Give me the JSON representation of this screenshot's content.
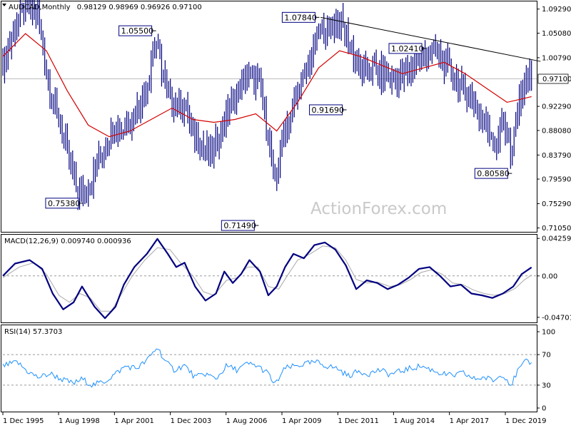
{
  "chart_data": [
    {
      "type": "bar",
      "subtype": "ohlc",
      "symbol_header": "AUDCAD,Monthly",
      "ohlc_header": "0.98129 0.98969 0.96926 0.97100",
      "current_price": 0.971,
      "current_price_label": "0.97100",
      "watermark": "ActionForex.com",
      "ylim": [
        0.705,
        1.105
      ],
      "yticks": [
        {
          "value": 1.0929,
          "label": "1.09290"
        },
        {
          "value": 1.0508,
          "label": "1.05080"
        },
        {
          "value": 1.0079,
          "label": "1.00790"
        },
        {
          "value": 0.9229,
          "label": "0.92290"
        },
        {
          "value": 0.8808,
          "label": "0.88080"
        },
        {
          "value": 0.8379,
          "label": "0.83790"
        },
        {
          "value": 0.7959,
          "label": "0.79590"
        },
        {
          "value": 0.7529,
          "label": "0.75290"
        },
        {
          "value": 0.7105,
          "label": "0.71050"
        }
      ],
      "x_range": [
        1995.92,
        2021.42
      ],
      "xticks": [
        {
          "x": 1995.92,
          "label": "1 Dec 1995"
        },
        {
          "x": 1998.58,
          "label": "1 Aug 1998"
        },
        {
          "x": 2001.25,
          "label": "1 Apr 2001"
        },
        {
          "x": 2003.92,
          "label": "1 Dec 2003"
        },
        {
          "x": 2006.58,
          "label": "1 Aug 2006"
        },
        {
          "x": 2009.25,
          "label": "1 Apr 2009"
        },
        {
          "x": 2011.92,
          "label": "1 Dec 2011"
        },
        {
          "x": 2014.58,
          "label": "1 Aug 2014"
        },
        {
          "x": 2017.25,
          "label": "1 Apr 2017"
        },
        {
          "x": 2019.92,
          "label": "1 Dec 2019"
        }
      ],
      "price_path": [
        [
          1995.92,
          1.0
        ],
        [
          1996.5,
          1.06
        ],
        [
          1996.9,
          1.095
        ],
        [
          1997.6,
          1.085
        ],
        [
          1998.1,
          0.96
        ],
        [
          1998.9,
          0.86
        ],
        [
          1999.4,
          0.78
        ],
        [
          1999.8,
          0.765
        ],
        [
          2000.3,
          0.81
        ],
        [
          2000.9,
          0.86
        ],
        [
          2001.2,
          0.89
        ],
        [
          2001.6,
          0.88
        ],
        [
          2002.0,
          0.9
        ],
        [
          2002.4,
          0.92
        ],
        [
          2002.8,
          0.96
        ],
        [
          2003.2,
          1.04
        ],
        [
          2003.4,
          1.01
        ],
        [
          2003.8,
          0.94
        ],
        [
          2004.2,
          0.93
        ],
        [
          2004.6,
          0.92
        ],
        [
          2005.0,
          0.88
        ],
        [
          2005.5,
          0.85
        ],
        [
          2005.9,
          0.84
        ],
        [
          2006.3,
          0.88
        ],
        [
          2006.7,
          0.92
        ],
        [
          2007.2,
          0.95
        ],
        [
          2007.6,
          0.98
        ],
        [
          2008.2,
          0.96
        ],
        [
          2008.6,
          0.87
        ],
        [
          2008.9,
          0.78
        ],
        [
          2009.2,
          0.86
        ],
        [
          2009.6,
          0.9
        ],
        [
          2009.9,
          0.94
        ],
        [
          2010.3,
          0.97
        ],
        [
          2010.7,
          1.02
        ],
        [
          2011.0,
          1.05
        ],
        [
          2011.5,
          1.06
        ],
        [
          2011.9,
          1.07
        ],
        [
          2012.2,
          1.06
        ],
        [
          2012.5,
          1.03
        ],
        [
          2012.8,
          1.0
        ],
        [
          2013.2,
          0.98
        ],
        [
          2013.6,
          0.99
        ],
        [
          2014.0,
          0.98
        ],
        [
          2014.4,
          0.97
        ],
        [
          2014.8,
          0.97
        ],
        [
          2015.2,
          0.98
        ],
        [
          2015.6,
          1.0
        ],
        [
          2016.0,
          1.01
        ],
        [
          2016.4,
          1.02
        ],
        [
          2016.8,
          1.01
        ],
        [
          2017.2,
          0.99
        ],
        [
          2017.6,
          0.97
        ],
        [
          2018.0,
          0.95
        ],
        [
          2018.4,
          0.93
        ],
        [
          2018.8,
          0.9
        ],
        [
          2019.2,
          0.88
        ],
        [
          2019.5,
          0.86
        ],
        [
          2019.8,
          0.9
        ],
        [
          2020.1,
          0.87
        ],
        [
          2020.2,
          0.81
        ],
        [
          2020.4,
          0.9
        ],
        [
          2020.7,
          0.95
        ],
        [
          2021.0,
          0.98
        ],
        [
          2021.17,
          0.975
        ]
      ],
      "ma_path": [
        [
          1995.92,
          1.01
        ],
        [
          1997.0,
          1.05
        ],
        [
          1998.0,
          1.02
        ],
        [
          1999.0,
          0.95
        ],
        [
          2000.0,
          0.89
        ],
        [
          2001.0,
          0.87
        ],
        [
          2002.0,
          0.88
        ],
        [
          2003.0,
          0.9
        ],
        [
          2004.0,
          0.92
        ],
        [
          2005.0,
          0.9
        ],
        [
          2006.0,
          0.895
        ],
        [
          2007.0,
          0.9
        ],
        [
          2008.0,
          0.91
        ],
        [
          2009.0,
          0.88
        ],
        [
          2010.0,
          0.93
        ],
        [
          2011.0,
          0.99
        ],
        [
          2012.0,
          1.02
        ],
        [
          2013.0,
          1.01
        ],
        [
          2014.0,
          0.995
        ],
        [
          2015.0,
          0.98
        ],
        [
          2016.0,
          0.99
        ],
        [
          2017.0,
          1.0
        ],
        [
          2018.0,
          0.98
        ],
        [
          2019.0,
          0.955
        ],
        [
          2020.0,
          0.93
        ],
        [
          2020.6,
          0.935
        ],
        [
          2021.17,
          0.94
        ]
      ],
      "trendline": [
        [
          2011.1,
          1.0784
        ],
        [
          2021.6,
          1.0015
        ]
      ],
      "annotations": [
        {
          "label": "1.05500",
          "x": 2003.1,
          "y": 1.055
        },
        {
          "label": "1.07840",
          "x": 2010.9,
          "y": 1.0784
        },
        {
          "label": "1.02410",
          "x": 2016.0,
          "y": 1.0241
        },
        {
          "label": "0.75380",
          "x": 1999.6,
          "y": 0.7538
        },
        {
          "label": "0.91690",
          "x": 2012.2,
          "y": 0.9169
        },
        {
          "label": "0.71490",
          "x": 2008.0,
          "y": 0.7149
        },
        {
          "label": "0.80580",
          "x": 2020.1,
          "y": 0.8058
        }
      ]
    },
    {
      "type": "line",
      "title": "MACD(12,26,9) 0.009740 0.000936",
      "ylim": [
        -0.052,
        0.046
      ],
      "yticks": [
        {
          "value": 0.042599,
          "label": "0.042599"
        },
        {
          "value": 0.0,
          "label": "0.00"
        },
        {
          "value": -0.047016,
          "label": "-0.047016"
        }
      ],
      "macd": [
        [
          1995.92,
          0.0
        ],
        [
          1996.5,
          0.014
        ],
        [
          1997.2,
          0.018
        ],
        [
          1997.8,
          0.008
        ],
        [
          1998.3,
          -0.02
        ],
        [
          1998.8,
          -0.038
        ],
        [
          1999.3,
          -0.03
        ],
        [
          1999.7,
          -0.012
        ],
        [
          2000.3,
          -0.035
        ],
        [
          2000.8,
          -0.048
        ],
        [
          2001.3,
          -0.035
        ],
        [
          2001.7,
          -0.01
        ],
        [
          2002.2,
          0.01
        ],
        [
          2002.8,
          0.025
        ],
        [
          2003.3,
          0.042
        ],
        [
          2003.8,
          0.025
        ],
        [
          2004.2,
          0.01
        ],
        [
          2004.6,
          0.015
        ],
        [
          2005.1,
          -0.012
        ],
        [
          2005.6,
          -0.028
        ],
        [
          2006.1,
          -0.02
        ],
        [
          2006.5,
          0.005
        ],
        [
          2006.9,
          -0.008
        ],
        [
          2007.3,
          0.002
        ],
        [
          2007.7,
          0.018
        ],
        [
          2008.2,
          0.005
        ],
        [
          2008.6,
          -0.022
        ],
        [
          2009.0,
          -0.012
        ],
        [
          2009.4,
          0.01
        ],
        [
          2009.8,
          0.025
        ],
        [
          2010.3,
          0.02
        ],
        [
          2010.8,
          0.035
        ],
        [
          2011.3,
          0.038
        ],
        [
          2011.8,
          0.03
        ],
        [
          2012.3,
          0.012
        ],
        [
          2012.8,
          -0.015
        ],
        [
          2013.3,
          -0.005
        ],
        [
          2013.8,
          -0.008
        ],
        [
          2014.3,
          -0.015
        ],
        [
          2014.8,
          -0.01
        ],
        [
          2015.3,
          -0.002
        ],
        [
          2015.8,
          0.008
        ],
        [
          2016.3,
          0.01
        ],
        [
          2016.8,
          0.0
        ],
        [
          2017.3,
          -0.012
        ],
        [
          2017.8,
          -0.01
        ],
        [
          2018.3,
          -0.02
        ],
        [
          2018.8,
          -0.022
        ],
        [
          2019.3,
          -0.025
        ],
        [
          2019.8,
          -0.02
        ],
        [
          2020.3,
          -0.012
        ],
        [
          2020.7,
          0.002
        ],
        [
          2021.17,
          0.00974
        ]
      ],
      "signal": [
        [
          1995.92,
          -0.002
        ],
        [
          1996.7,
          0.01
        ],
        [
          1997.4,
          0.015
        ],
        [
          1998.0,
          0.002
        ],
        [
          1998.6,
          -0.022
        ],
        [
          1999.1,
          -0.03
        ],
        [
          1999.6,
          -0.02
        ],
        [
          2000.1,
          -0.025
        ],
        [
          2000.6,
          -0.04
        ],
        [
          2001.1,
          -0.04
        ],
        [
          2001.6,
          -0.02
        ],
        [
          2002.1,
          0.0
        ],
        [
          2002.7,
          0.018
        ],
        [
          2003.3,
          0.032
        ],
        [
          2003.9,
          0.03
        ],
        [
          2004.4,
          0.015
        ],
        [
          2005.0,
          0.0
        ],
        [
          2005.5,
          -0.018
        ],
        [
          2006.0,
          -0.022
        ],
        [
          2006.6,
          -0.005
        ],
        [
          2007.1,
          -0.002
        ],
        [
          2007.6,
          0.01
        ],
        [
          2008.1,
          0.01
        ],
        [
          2008.6,
          -0.012
        ],
        [
          2009.1,
          -0.015
        ],
        [
          2009.5,
          0.0
        ],
        [
          2010.0,
          0.018
        ],
        [
          2010.6,
          0.025
        ],
        [
          2011.2,
          0.034
        ],
        [
          2011.8,
          0.032
        ],
        [
          2012.3,
          0.018
        ],
        [
          2012.8,
          -0.004
        ],
        [
          2013.3,
          -0.008
        ],
        [
          2013.8,
          -0.007
        ],
        [
          2014.4,
          -0.012
        ],
        [
          2014.9,
          -0.01
        ],
        [
          2015.4,
          -0.004
        ],
        [
          2015.9,
          0.004
        ],
        [
          2016.4,
          0.007
        ],
        [
          2016.9,
          0.002
        ],
        [
          2017.4,
          -0.008
        ],
        [
          2017.9,
          -0.01
        ],
        [
          2018.4,
          -0.016
        ],
        [
          2018.9,
          -0.02
        ],
        [
          2019.4,
          -0.022
        ],
        [
          2019.9,
          -0.02
        ],
        [
          2020.4,
          -0.014
        ],
        [
          2020.8,
          -0.005
        ],
        [
          2021.17,
          0.000936
        ]
      ]
    },
    {
      "type": "line",
      "title": "RSI(14) 57.3703",
      "ylim": [
        0,
        100
      ],
      "yticks": [
        {
          "value": 100,
          "label": "100"
        },
        {
          "value": 70,
          "label": "70"
        },
        {
          "value": 30,
          "label": "30"
        },
        {
          "value": 0,
          "label": "0"
        }
      ],
      "levels": [
        70,
        30
      ],
      "rsi": [
        [
          1995.92,
          55
        ],
        [
          1996.6,
          60
        ],
        [
          1997.1,
          48
        ],
        [
          1997.6,
          40
        ],
        [
          1998.2,
          45
        ],
        [
          1998.7,
          38
        ],
        [
          1999.3,
          32
        ],
        [
          1999.7,
          38
        ],
        [
          2000.2,
          30
        ],
        [
          2000.8,
          35
        ],
        [
          2001.3,
          45
        ],
        [
          2001.8,
          55
        ],
        [
          2002.3,
          52
        ],
        [
          2002.8,
          62
        ],
        [
          2003.3,
          80
        ],
        [
          2003.7,
          60
        ],
        [
          2004.1,
          50
        ],
        [
          2004.6,
          56
        ],
        [
          2005.1,
          40
        ],
        [
          2005.6,
          45
        ],
        [
          2006.1,
          38
        ],
        [
          2006.6,
          55
        ],
        [
          2007.1,
          50
        ],
        [
          2007.6,
          58
        ],
        [
          2008.1,
          55
        ],
        [
          2008.6,
          45
        ],
        [
          2008.9,
          30
        ],
        [
          2009.4,
          52
        ],
        [
          2009.9,
          55
        ],
        [
          2010.4,
          58
        ],
        [
          2010.9,
          60
        ],
        [
          2011.4,
          55
        ],
        [
          2011.9,
          52
        ],
        [
          2012.4,
          42
        ],
        [
          2012.9,
          48
        ],
        [
          2013.4,
          45
        ],
        [
          2013.9,
          50
        ],
        [
          2014.4,
          44
        ],
        [
          2014.9,
          48
        ],
        [
          2015.4,
          52
        ],
        [
          2015.9,
          55
        ],
        [
          2016.4,
          50
        ],
        [
          2016.9,
          45
        ],
        [
          2017.4,
          42
        ],
        [
          2017.9,
          46
        ],
        [
          2018.4,
          38
        ],
        [
          2018.9,
          40
        ],
        [
          2019.4,
          36
        ],
        [
          2019.8,
          45
        ],
        [
          2020.2,
          30
        ],
        [
          2020.5,
          48
        ],
        [
          2020.8,
          58
        ],
        [
          2021.0,
          62
        ],
        [
          2021.17,
          57.37
        ]
      ]
    }
  ]
}
